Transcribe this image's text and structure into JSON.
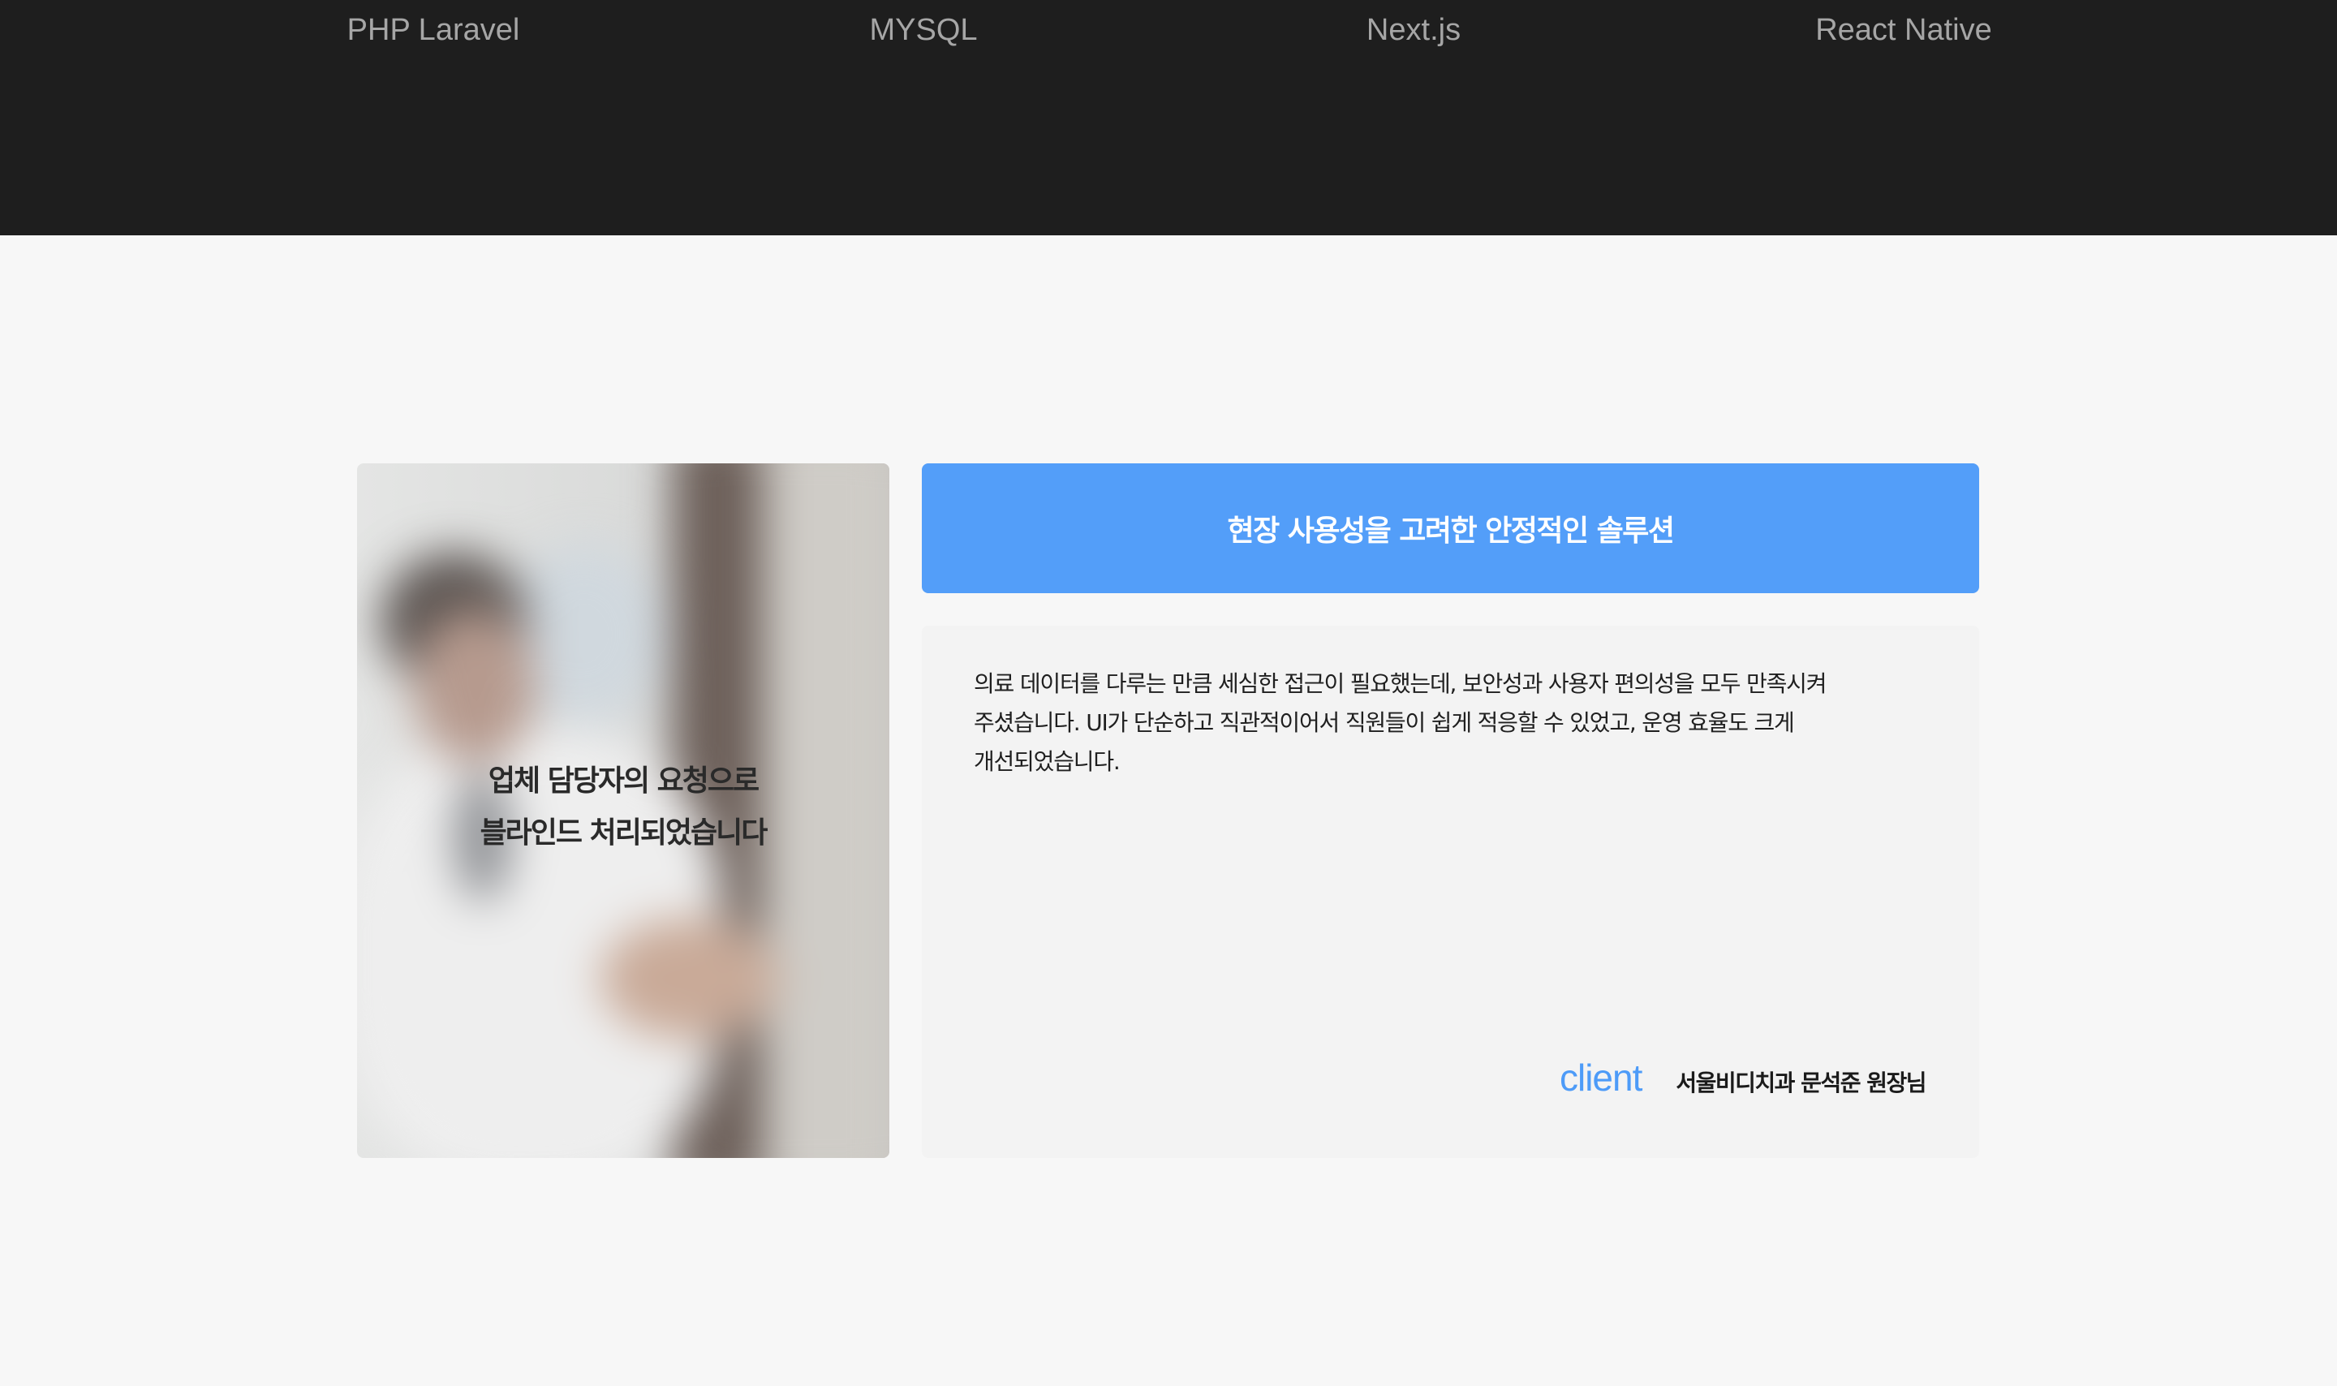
{
  "tech_stack": [
    "PHP Laravel",
    "MYSQL",
    "Next.js",
    "React Native"
  ],
  "testimonial": {
    "photo_notice_line1": "업체 담당자의 요청으로",
    "photo_notice_line2": "블라인드 처리되었습니다",
    "title": "현장 사용성을 고려한 안정적인 솔루션",
    "quote": "의료 데이터를 다루는 만큼 세심한 접근이 필요했는데, 보안성과 사용자 편의성을 모두 만족시켜 주셨습니다. UI가 단순하고 직관적이어서 직원들이 쉽게 적응할 수 있었고, 운영 효율도 크게 개선되었습니다.",
    "client_label": "client",
    "client_name": "서울비디치과 문석준 원장님"
  },
  "colors": {
    "header_bg": "#1e1e1e",
    "page_bg": "#f7f7f7",
    "accent": "#539ef9",
    "client_label": "#4d9bf8"
  }
}
